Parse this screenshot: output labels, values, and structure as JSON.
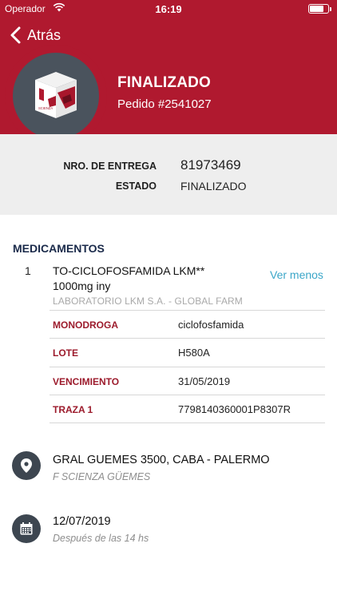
{
  "status_bar": {
    "carrier": "Operador",
    "time": "16:19"
  },
  "nav": {
    "back_label": "Atrás"
  },
  "order": {
    "status": "FINALIZADO",
    "number": "Pedido #2541027",
    "product_brand": "SCIENZA"
  },
  "summary": {
    "delivery_label": "NRO. DE ENTREGA",
    "delivery_value": "81973469",
    "state_label": "ESTADO",
    "state_value": "FINALIZADO"
  },
  "medications": {
    "title": "MEDICAMENTOS",
    "items": [
      {
        "index": "1",
        "name_line1": "TO-CICLOFOSFAMIDA LKM**",
        "name_line2": "1000mg iny",
        "toggle_label": "Ver menos",
        "lab": "LABORATORIO  LKM S.A. - GLOBAL FARM",
        "details": [
          {
            "label": "MONODROGA",
            "value": "ciclofosfamida"
          },
          {
            "label": "LOTE",
            "value": "H580A"
          },
          {
            "label": "VENCIMIENTO",
            "value": "31/05/2019"
          },
          {
            "label": "TRAZA 1",
            "value": "7798140360001P8307R"
          }
        ]
      }
    ]
  },
  "address": {
    "main": "GRAL GUEMES 3500, CABA - PALERMO",
    "sub": "F SCIENZA GÜEMES",
    "icon": "location-pin-icon"
  },
  "schedule": {
    "date": "12/07/2019",
    "note": "Después de las 14 hs",
    "icon": "calendar-icon"
  },
  "colors": {
    "brand_red": "#b0192f",
    "label_red": "#9c1b2c",
    "link_blue": "#3ba6c8",
    "icon_dark": "#3d4650"
  }
}
